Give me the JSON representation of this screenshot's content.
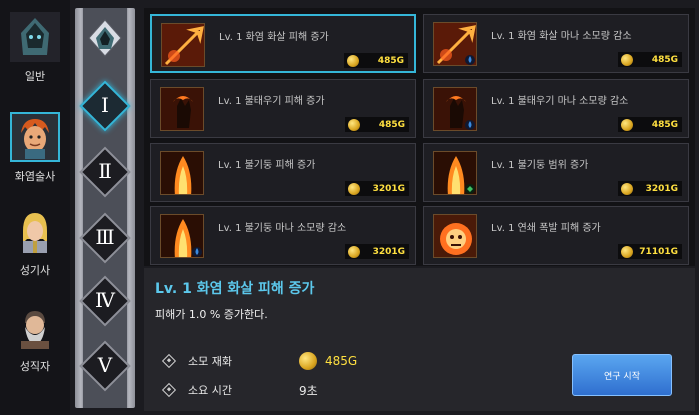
{
  "classes": [
    {
      "label": "일반",
      "icon": "hooded-mage-portrait"
    },
    {
      "label": "화염술사",
      "icon": "fire-mage-portrait"
    },
    {
      "label": "성기사",
      "icon": "paladin-portrait"
    },
    {
      "label": "성직자",
      "icon": "priest-portrait"
    }
  ],
  "tiers": [
    "Ⅰ",
    "Ⅱ",
    "Ⅲ",
    "Ⅳ",
    "Ⅴ"
  ],
  "skills": [
    {
      "name": "Lv. 1 화염 화살 피해 증가",
      "cost": "485G",
      "icon": "fire-arrow-icon"
    },
    {
      "name": "Lv. 1 화염 화살 마나 소모량 감소",
      "cost": "485G",
      "icon": "fire-arrow-icon"
    },
    {
      "name": "Lv. 1 불태우기 피해 증가",
      "cost": "485G",
      "icon": "burn-hand-icon"
    },
    {
      "name": "Lv. 1 불태우기 마나 소모량 감소",
      "cost": "485G",
      "icon": "burn-hand-icon"
    },
    {
      "name": "Lv. 1 불기둥 피해 증가",
      "cost": "3201G",
      "icon": "fire-pillar-icon"
    },
    {
      "name": "Lv. 1 불기둥 범위 증가",
      "cost": "3201G",
      "icon": "fire-pillar-icon"
    },
    {
      "name": "Lv. 1 불기둥 마나 소모량 감소",
      "cost": "3201G",
      "icon": "fire-pillar-icon"
    },
    {
      "name": "Lv. 1 연쇄 폭발 피해 증가",
      "cost": "71101G",
      "icon": "chain-explosion-icon"
    }
  ],
  "detail": {
    "title": "Lv. 1 화염 화살 피해 증가",
    "description": "피해가 1.0 % 증가한다.",
    "cost_label": "소모 재화",
    "cost_value": "485G",
    "time_label": "소요 시간",
    "time_value": "9초",
    "start_button": "연구 시작"
  },
  "colors": {
    "accent": "#35b6d8",
    "gold": "#ffe040",
    "title": "#5cc8ec"
  }
}
